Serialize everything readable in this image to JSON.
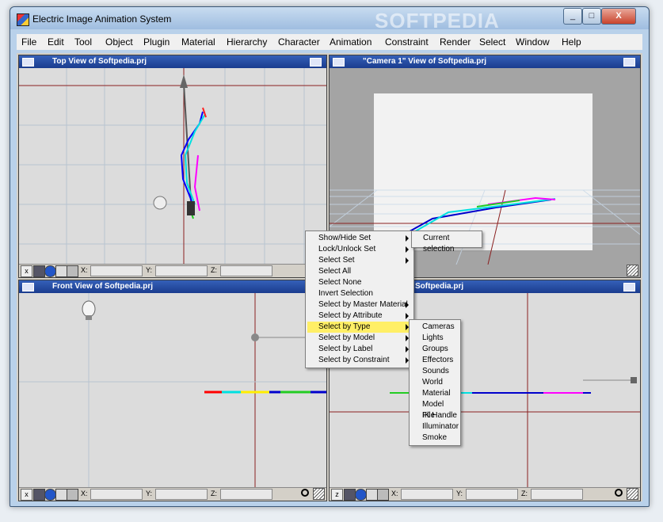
{
  "app": {
    "title": "Electric Image Animation System",
    "watermark": "SOFTPEDIA",
    "window_buttons": [
      "_",
      "□",
      "X"
    ]
  },
  "menubar": {
    "items": [
      "File",
      "Edit",
      "Tool",
      "Object",
      "Plugin",
      "Material",
      "Hierarchy",
      "Character",
      "Animation",
      "Constraint",
      "Render",
      "Select",
      "Window",
      "Help"
    ]
  },
  "viewports": {
    "top": {
      "title": "Top View of Softpedia.prj"
    },
    "camera": {
      "title": "\"Camera 1\" View of Softpedia.prj"
    },
    "front": {
      "title": "Front View of Softpedia.prj"
    },
    "side": {
      "title": "Softpedia.prj"
    }
  },
  "coord_labels": {
    "x": "X:",
    "y": "Y:",
    "z": "Z:"
  },
  "status_icons": [
    "axis-icon",
    "film-icon",
    "globe-icon",
    "camera-icon",
    "palette-icon"
  ],
  "context_menu": {
    "items": [
      {
        "label": "Show/Hide Set",
        "submenu": true
      },
      {
        "label": "Lock/Unlock Set",
        "submenu": true
      },
      {
        "label": "Select Set",
        "submenu": true
      },
      {
        "label": "Select All",
        "submenu": false
      },
      {
        "label": "Select None",
        "submenu": false
      },
      {
        "label": "Invert Selection",
        "submenu": false
      },
      {
        "label": "Select by Master Material",
        "submenu": true
      },
      {
        "label": "Select by Attribute",
        "submenu": true
      },
      {
        "label": "Select by Type",
        "submenu": true,
        "highlighted": true
      },
      {
        "label": "Select by Model",
        "submenu": true
      },
      {
        "label": "Select by Label",
        "submenu": true
      },
      {
        "label": "Select by Constraint",
        "submenu": true
      }
    ]
  },
  "set_submenu": {
    "items": [
      "Current selection"
    ]
  },
  "type_submenu": {
    "items": [
      "Cameras",
      "Lights",
      "Groups",
      "Effectors",
      "Sounds",
      "World",
      "Material",
      "Model File",
      "IK Handle",
      "Illuminator",
      "Smoke"
    ]
  },
  "colors": {
    "titlebar_vp": "#1a3c8e",
    "highlight": "#ffef66",
    "grid_line": "#8a2020"
  }
}
